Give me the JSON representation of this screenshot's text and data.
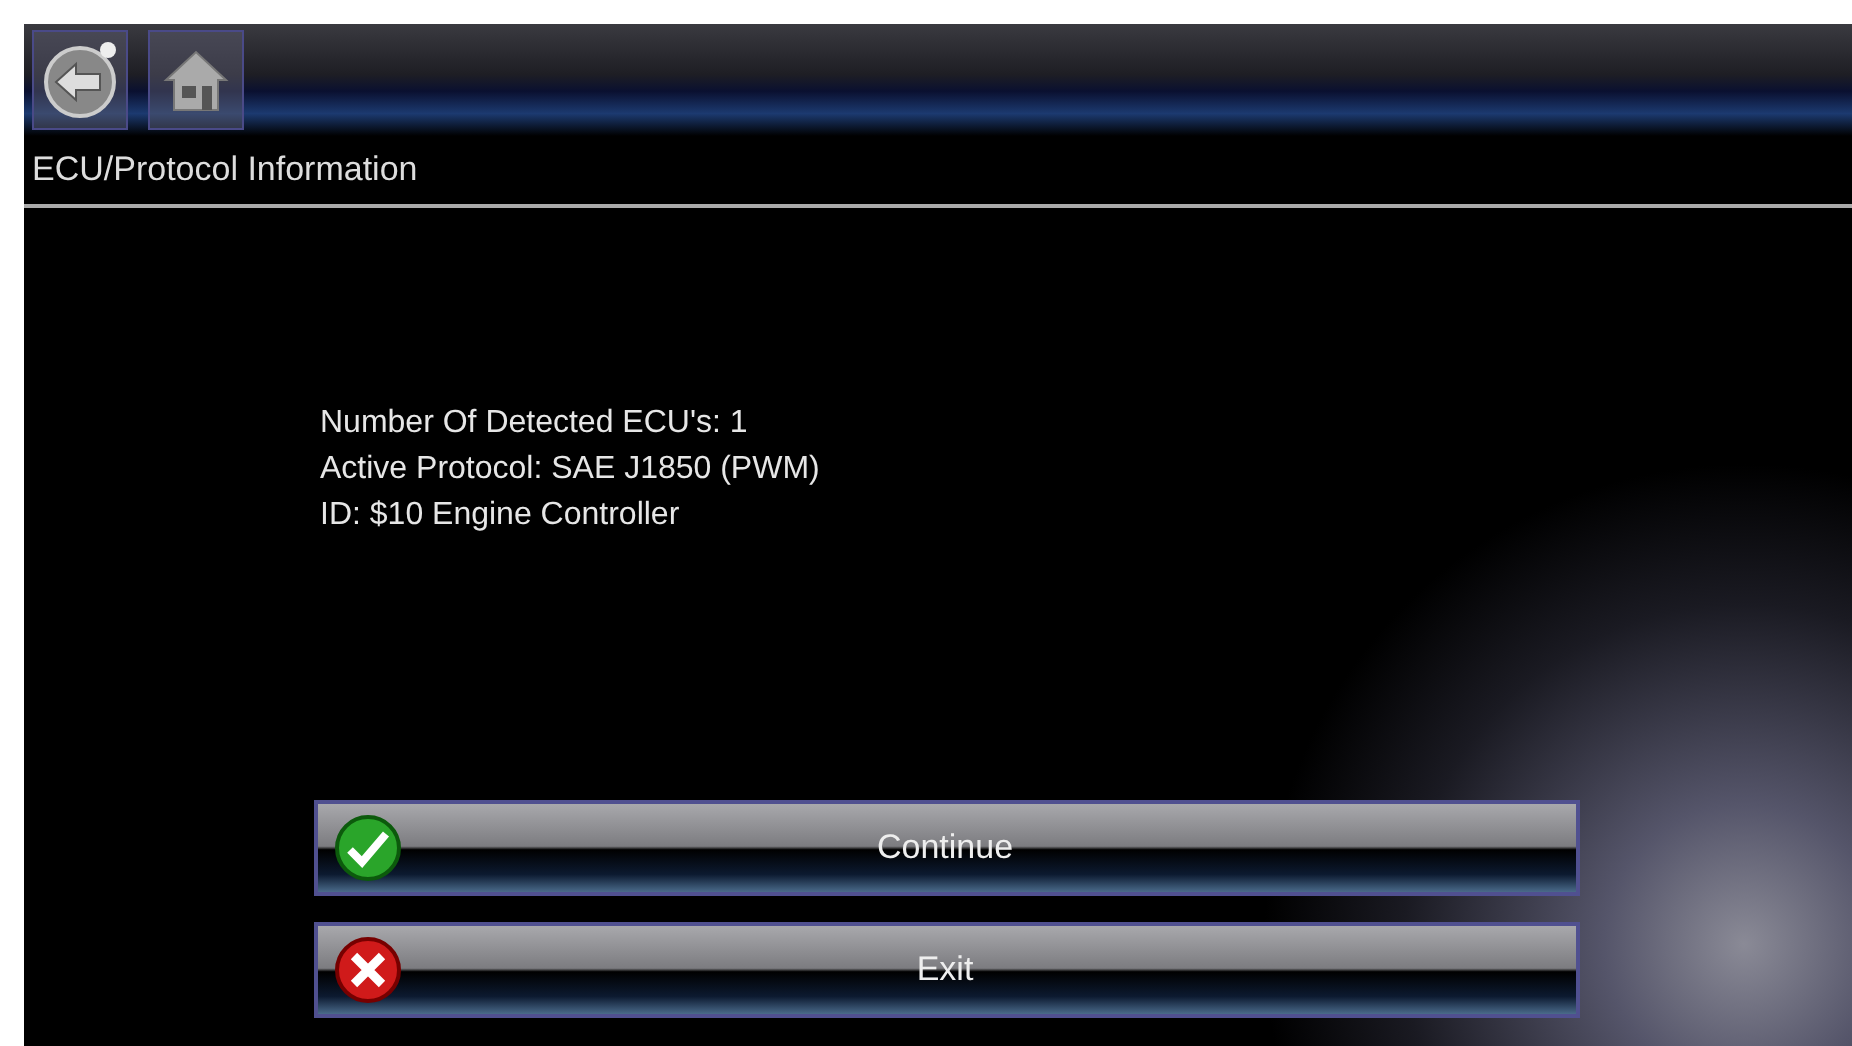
{
  "screen": {
    "title": "ECU/Protocol Information"
  },
  "info_lines": [
    "Number Of Detected ECU's: 1",
    "Active Protocol: SAE J1850 (PWM)",
    "ID: $10 Engine Controller"
  ],
  "buttons": [
    {
      "label": "Continue",
      "kind": "confirm"
    },
    {
      "label": "Exit",
      "kind": "cancel"
    }
  ]
}
